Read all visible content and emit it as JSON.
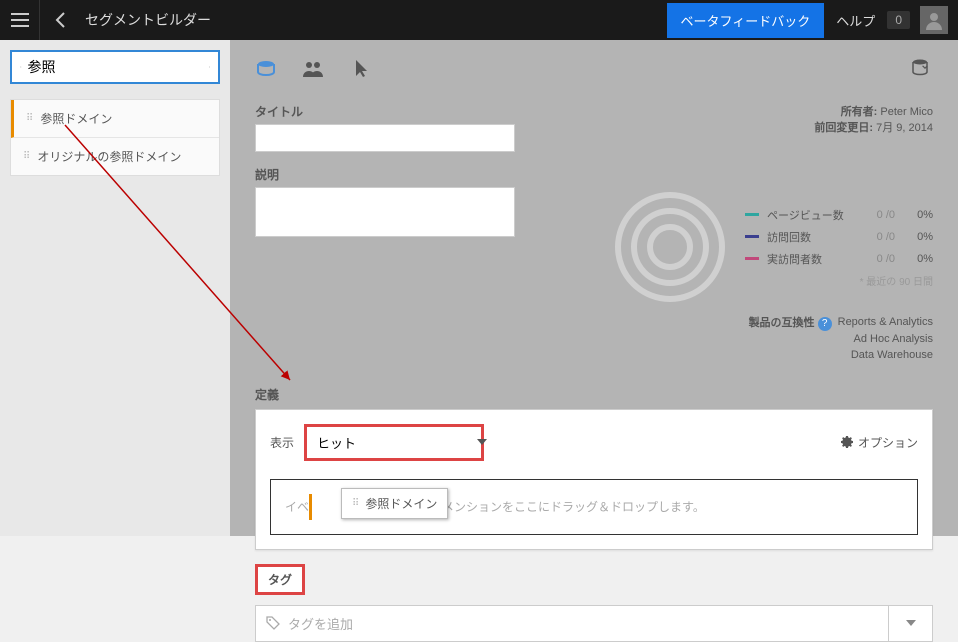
{
  "header": {
    "title": "セグメントビルダー",
    "feedback": "ベータフィードバック",
    "help": "ヘルプ",
    "badge": "0"
  },
  "sidebar": {
    "search_value": "参照",
    "items": [
      {
        "label": "参照ドメイン"
      },
      {
        "label": "オリジナルの参照ドメイン"
      }
    ]
  },
  "meta": {
    "title_label": "タイトル",
    "desc_label": "説明",
    "owner_label": "所有者:",
    "owner_value": "Peter Mico",
    "modified_label": "前回変更日:",
    "modified_value": "7月 9, 2014"
  },
  "metrics": {
    "rows": [
      {
        "color": "#2fa6a0",
        "label": "ページビュー数",
        "val": "0 /0",
        "pct": "0%"
      },
      {
        "color": "#3b3f8f",
        "label": "訪問回数",
        "val": "0 /0",
        "pct": "0%"
      },
      {
        "color": "#c1487a",
        "label": "実訪問者数",
        "val": "0 /0",
        "pct": "0%"
      }
    ],
    "note": "* 最近の 90 日間"
  },
  "compat": {
    "label": "製品の互換性",
    "products": [
      "Reports & Analytics",
      "Ad Hoc Analysis",
      "Data Warehouse"
    ]
  },
  "definition": {
    "label": "定義",
    "show_label": "表示",
    "show_value": "ヒット",
    "options": "オプション",
    "dropzone_prefix": "イベ",
    "dropzone_hint": "ィメンションをここにドラッグ＆ドロップします。",
    "drag_chip": "参照ドメイン"
  },
  "tags": {
    "label": "タグ",
    "placeholder": "タグを追加"
  }
}
